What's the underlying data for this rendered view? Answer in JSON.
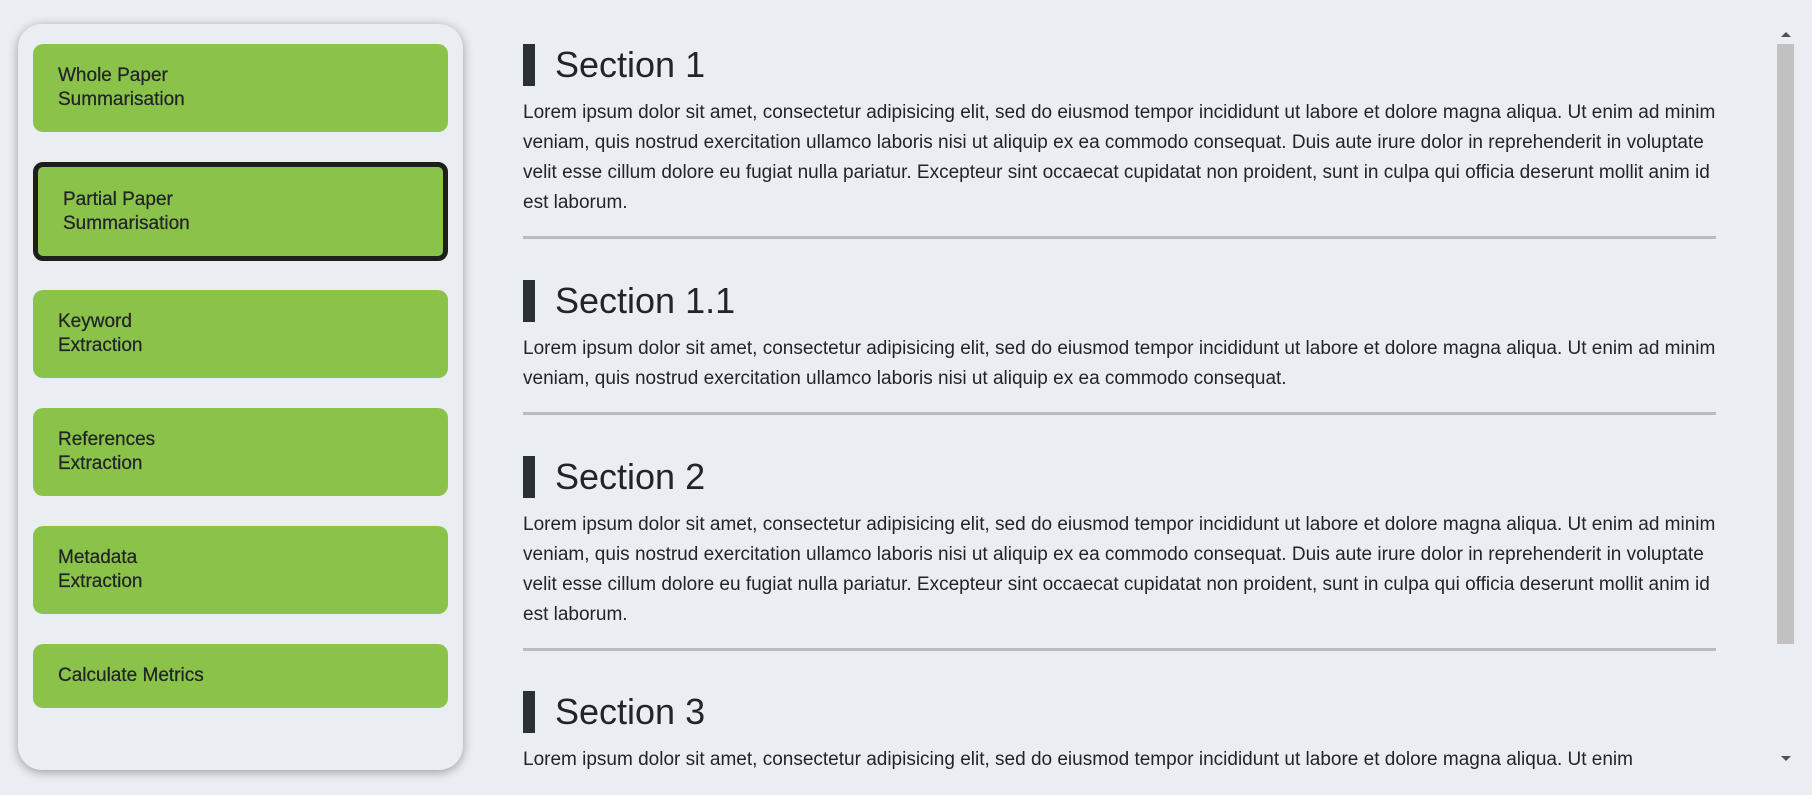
{
  "sidebar": {
    "items": [
      {
        "label": "Whole Paper\nSummarisation",
        "active": false
      },
      {
        "label": "Partial Paper\nSummarisation",
        "active": true
      },
      {
        "label": "Keyword\nExtraction",
        "active": false
      },
      {
        "label": "References\nExtraction",
        "active": false
      },
      {
        "label": "Metadata\nExtraction",
        "active": false
      },
      {
        "label": "Calculate Metrics",
        "active": false
      }
    ]
  },
  "sections": [
    {
      "title": "Section 1",
      "body": "Lorem ipsum dolor sit amet, consectetur adipisicing elit, sed do eiusmod tempor incididunt ut labore et dolore magna aliqua. Ut enim ad minim veniam, quis nostrud exercitation ullamco laboris nisi ut aliquip ex ea commodo consequat. Duis aute irure dolor in reprehenderit in voluptate velit esse cillum dolore eu fugiat nulla pariatur. Excepteur sint occaecat cupidatat non proident, sunt in culpa qui officia deserunt mollit anim id est laborum."
    },
    {
      "title": "Section 1.1",
      "body": "Lorem ipsum dolor sit amet, consectetur adipisicing elit, sed do eiusmod tempor incididunt ut labore et dolore magna aliqua. Ut enim ad minim veniam, quis nostrud exercitation ullamco laboris nisi ut aliquip ex ea commodo consequat."
    },
    {
      "title": "Section 2",
      "body": "Lorem ipsum dolor sit amet, consectetur adipisicing elit, sed do eiusmod tempor incididunt ut labore et dolore magna aliqua. Ut enim ad minim veniam, quis nostrud exercitation ullamco laboris nisi ut aliquip ex ea commodo consequat. Duis aute irure dolor in reprehenderit in voluptate velit esse cillum dolore eu fugiat nulla pariatur. Excepteur sint occaecat cupidatat non proident, sunt in culpa qui officia deserunt mollit anim id est laborum."
    },
    {
      "title": "Section 3",
      "body": "Lorem ipsum dolor sit amet, consectetur adipisicing elit, sed do eiusmod tempor incididunt ut labore et dolore magna aliqua. Ut enim"
    }
  ],
  "colors": {
    "button_green": "#8bc34a",
    "background": "#eaeef2",
    "heading_bar": "#2b3034",
    "divider": "#b9bcbf"
  }
}
